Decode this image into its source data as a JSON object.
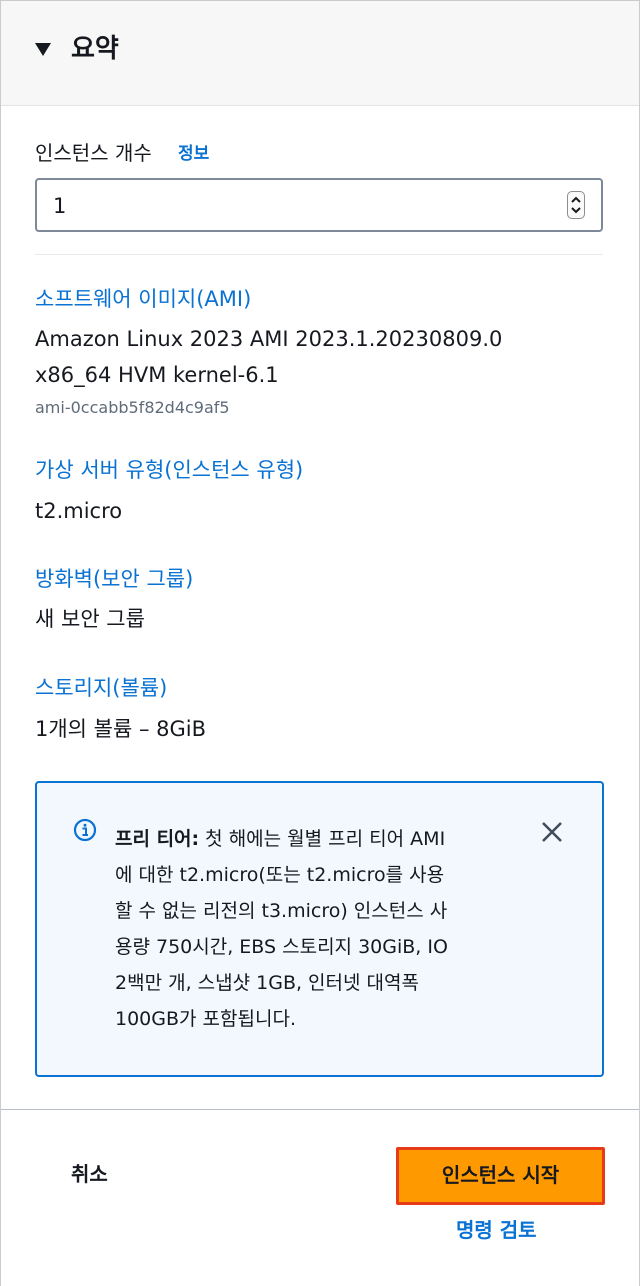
{
  "summary": {
    "title": "요약"
  },
  "instances": {
    "label": "인스턴스 개수",
    "info_link": "정보",
    "value": "1"
  },
  "ami": {
    "title": "소프트웨어 이미지(AMI)",
    "name_line1": "Amazon Linux 2023 AMI 2023.1.20230809.0",
    "name_line2": "x86_64 HVM kernel-6.1",
    "id": "ami-0ccabb5f82d4c9af5"
  },
  "instance_type": {
    "title": "가상 서버 유형(인스턴스 유형)",
    "value": "t2.micro"
  },
  "firewall": {
    "title": "방화벽(보안 그룹)",
    "value": "새 보안 그룹"
  },
  "storage": {
    "title": "스토리지(볼륨)",
    "value": "1개의 볼륨 – 8GiB"
  },
  "free_tier": {
    "heading": "프리 티어:",
    "line1": " 첫 해에는 월별 프리 티어 AMI",
    "line2": "에 대한 t2.micro(또는 t2.micro를 사용",
    "line3": "할 수 없는 리전의 t3.micro) 인스턴스 사",
    "line4": "용량 750시간, EBS 스토리지 30GiB, IO",
    "line5": "2백만 개, 스냅샷 1GB, 인터넷 대역폭",
    "line6": "100GB가 포함됩니다."
  },
  "footer": {
    "cancel_label": "취소",
    "launch_label": "인스턴스 시작",
    "review_label": "명령 검토"
  },
  "colors": {
    "link": "#0972d3",
    "primary_button": "#ff9900",
    "button_outline": "#e63b17",
    "info_bg": "#f2f8fd"
  },
  "icons": [
    "caret-down-icon",
    "spinner-up-icon",
    "spinner-down-icon",
    "info-icon",
    "close-icon"
  ]
}
